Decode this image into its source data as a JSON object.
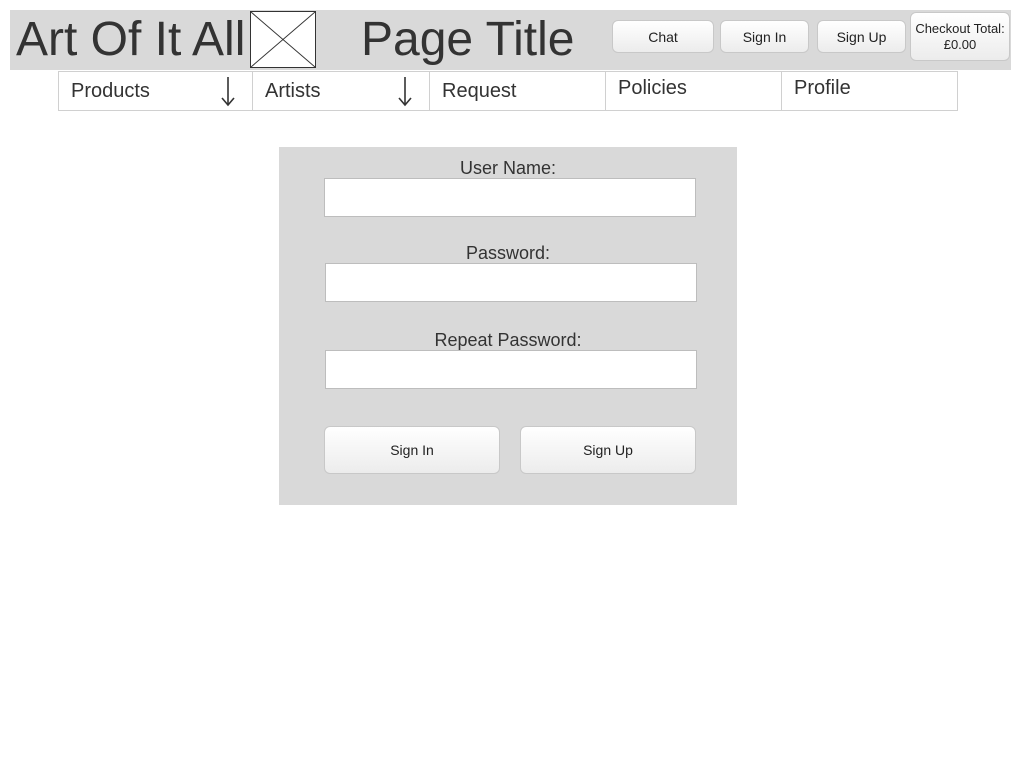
{
  "header": {
    "brand": "Art Of It All",
    "logo_icon": "image-placeholder-icon",
    "page_title": "Page Title",
    "buttons": {
      "chat": "Chat",
      "sign_in": "Sign In",
      "sign_up": "Sign Up",
      "checkout_line1": "Checkout Total:",
      "checkout_line2": "£0.00"
    }
  },
  "nav": {
    "items": [
      {
        "label": "Products",
        "icon": "arrow-down-icon"
      },
      {
        "label": "Artists",
        "icon": "arrow-down-icon"
      },
      {
        "label": "Request"
      },
      {
        "label": "Policies"
      },
      {
        "label": "Profile"
      }
    ]
  },
  "form": {
    "user_name_label": "User Name:",
    "user_name_value": "",
    "password_label": "Password:",
    "password_value": "",
    "repeat_password_label": "Repeat Password:",
    "repeat_password_value": "",
    "sign_in": "Sign In",
    "sign_up": "Sign Up"
  },
  "colors": {
    "panel_bg": "#d9d9d9",
    "text": "#333333",
    "page_bg": "#ffffff"
  }
}
